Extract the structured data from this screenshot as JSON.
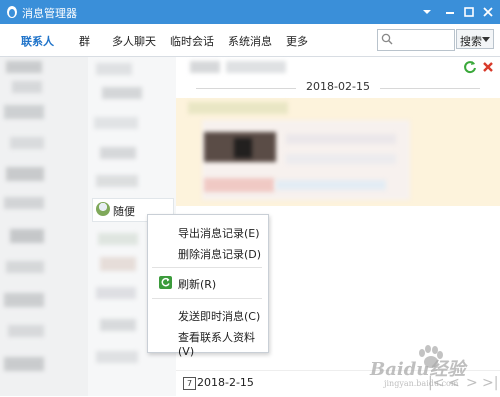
{
  "window": {
    "title": "消息管理器"
  },
  "toolbar": {
    "tabs": [
      {
        "label": "联系人",
        "active": true
      },
      {
        "label": "群"
      },
      {
        "label": "多人聊天"
      },
      {
        "label": "临时会话"
      },
      {
        "label": "系统消息"
      },
      {
        "label": "更多"
      }
    ],
    "search": {
      "placeholder": "",
      "button_label": "搜索"
    }
  },
  "contacts": {
    "selected_name": "随便"
  },
  "messages": {
    "date_separator": "2018-02-15"
  },
  "context_menu": {
    "items": [
      {
        "label": "导出消息记录(E)"
      },
      {
        "label": "删除消息记录(D)"
      },
      {
        "label": "刷新(R)"
      },
      {
        "label": "发送即时消息(C)"
      },
      {
        "label": "查看联系人资料(V)"
      }
    ]
  },
  "footer": {
    "date": "2018-2-15",
    "calendar_day": "7"
  },
  "watermark": {
    "text": "Baidu经验",
    "sub": "jingyan.baidu.com"
  },
  "colors": {
    "titlebar": "#3a8fd9",
    "active_tab": "#1f73c9",
    "message_bg": "#fdf3dc"
  }
}
